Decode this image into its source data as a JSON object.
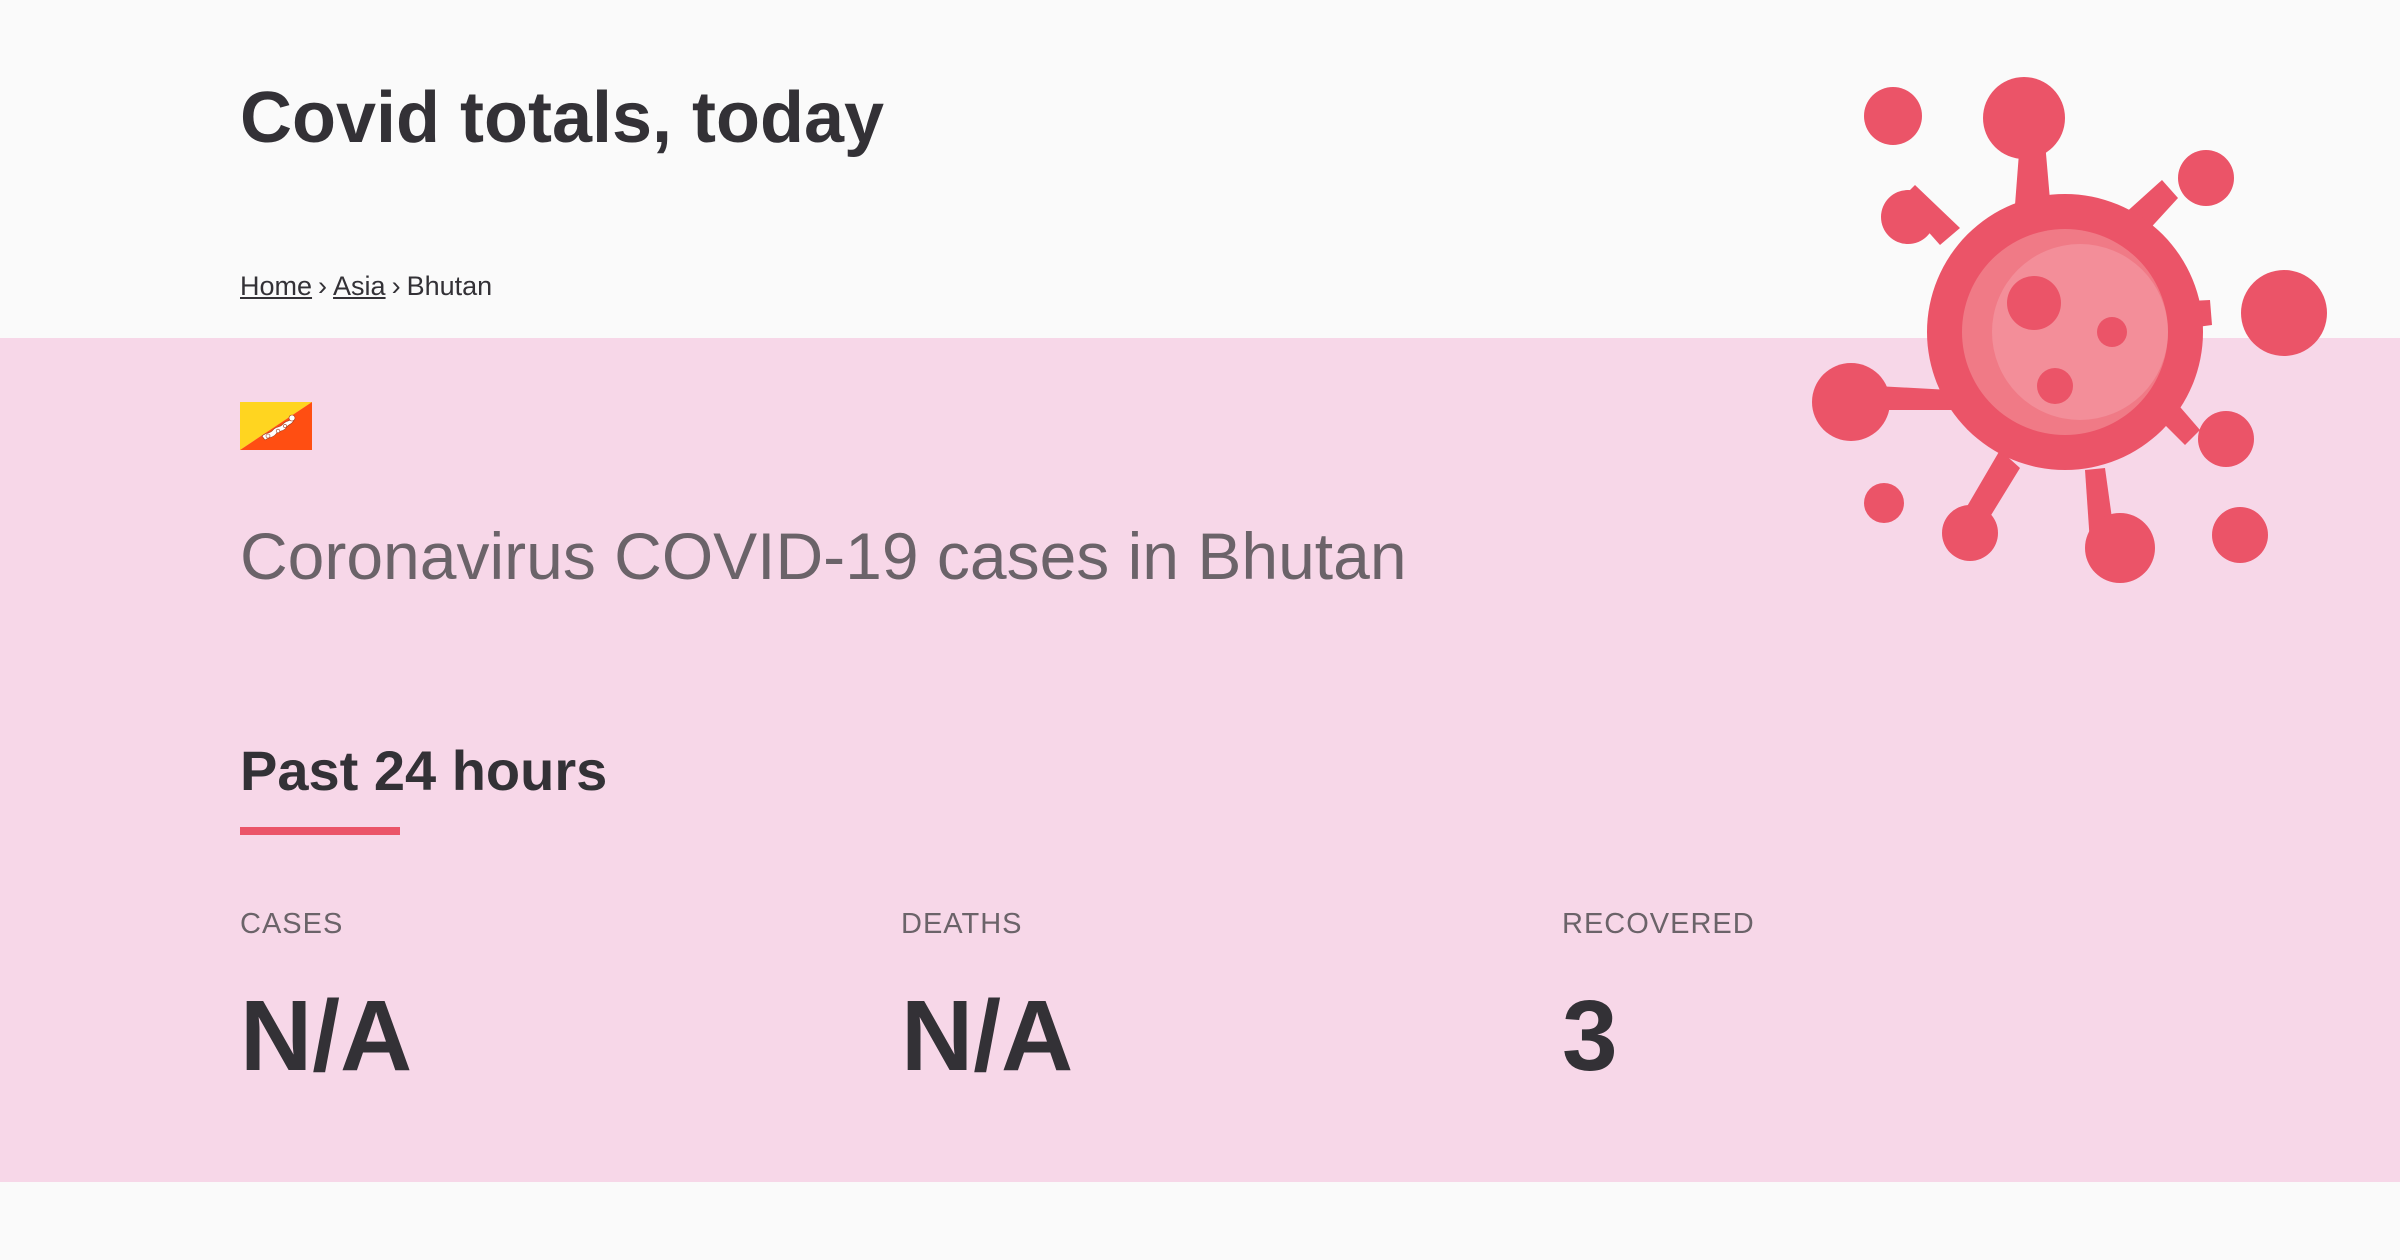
{
  "header": {
    "title": "Covid totals, today"
  },
  "breadcrumb": {
    "items": [
      {
        "label": "Home",
        "link": true
      },
      {
        "label": "Asia",
        "link": true
      },
      {
        "label": "Bhutan",
        "link": false
      }
    ],
    "separator": "›"
  },
  "country": {
    "flag_icon": "bhutan-flag-icon",
    "heading": "Coronavirus COVID-19 cases in Bhutan"
  },
  "period": {
    "heading": "Past 24 hours"
  },
  "stats": [
    {
      "label": "CASES",
      "value": "N/A"
    },
    {
      "label": "DEATHS",
      "value": "N/A"
    },
    {
      "label": "RECOVERED",
      "value": "3"
    }
  ],
  "colors": {
    "accent": "#eb5468",
    "band_background": "#f7d7e8",
    "page_background": "#fafafa",
    "text": "#333136",
    "muted_text": "#6b6369"
  },
  "illustration": {
    "icon": "virus-icon"
  }
}
